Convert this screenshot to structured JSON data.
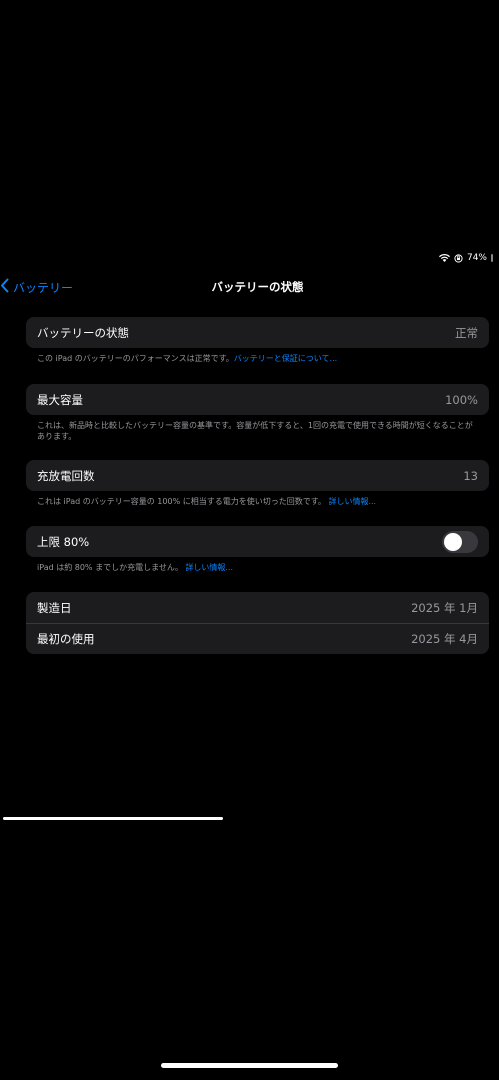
{
  "status_bar": {
    "battery_percent": "74%"
  },
  "nav": {
    "back_label": "バッテリー",
    "title": "バッテリーの状態"
  },
  "battery_health": {
    "label": "バッテリーの状態",
    "value": "正常",
    "footnote_text": "この iPad のバッテリーのパフォーマンスは正常です。",
    "footnote_link": "バッテリーと保証について..."
  },
  "max_capacity": {
    "label": "最大容量",
    "value": "100%",
    "footnote_text": "これは、新品時と比較したバッテリー容量の基準です。容量が低下すると、1回の充電で使用できる時間が短くなることがあります。"
  },
  "cycle_count": {
    "label": "充放電回数",
    "value": "13",
    "footnote_text": "これは iPad のバッテリー容量の 100% に相当する電力を使い切った回数です。",
    "footnote_link": "詳しい情報..."
  },
  "limit_80": {
    "label": "上限 80%",
    "toggle_on": false,
    "footnote_text": "iPad は約 80% までしか充電しません。",
    "footnote_link": "詳しい情報..."
  },
  "dates": {
    "manufacture_label": "製造日",
    "manufacture_value": "2025 年 1月",
    "first_use_label": "最初の使用",
    "first_use_value": "2025 年 4月"
  },
  "colors": {
    "accent": "#0a84ff",
    "background": "#000000",
    "group_background": "#1c1c1e",
    "secondary_text": "#98989d"
  }
}
